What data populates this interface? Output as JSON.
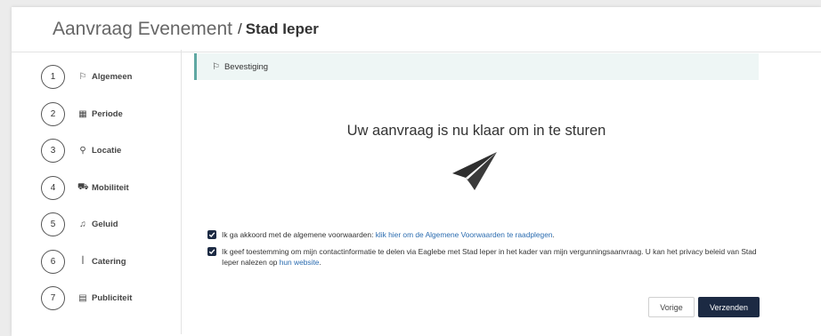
{
  "header": {
    "title": "Aanvraag Evenement",
    "separator": "/",
    "subtitle": "Stad Ieper"
  },
  "steps": [
    {
      "number": "1",
      "icon": "flag-icon",
      "glyph": "⚐",
      "label": "Algemeen"
    },
    {
      "number": "2",
      "icon": "calendar-icon",
      "glyph": "▦",
      "label": "Periode"
    },
    {
      "number": "3",
      "icon": "map-pin-icon",
      "glyph": "⚲",
      "label": "Locatie"
    },
    {
      "number": "4",
      "icon": "car-icon",
      "glyph": "⛟",
      "label": "Mobiliteit"
    },
    {
      "number": "5",
      "icon": "music-icon",
      "glyph": "♫",
      "label": "Geluid"
    },
    {
      "number": "6",
      "icon": "utensils-icon",
      "glyph": "ꟾ",
      "label": "Catering"
    },
    {
      "number": "7",
      "icon": "newspaper-icon",
      "glyph": "▤",
      "label": "Publiciteit"
    }
  ],
  "banner": {
    "icon": "flag-icon",
    "glyph": "⚐",
    "label": "Bevestiging"
  },
  "main": {
    "ready_text": "Uw aanvraag is nu klaar om in te sturen",
    "plane_icon": "paper-plane-icon"
  },
  "consents": [
    {
      "checked": true,
      "text": "Ik ga akkoord met de algemene voorwaarden: ",
      "link_text": "klik hier om de Algemene Voorwaarden te raadplegen",
      "suffix": "."
    },
    {
      "checked": true,
      "text": "Ik geef toestemming om mijn contactinformatie te delen via Eaglebe met Stad Ieper in het kader van mijn vergunningsaanvraag. U kan het privacy beleid van Stad Ieper nalezen op ",
      "link_text": "hun website",
      "suffix": "."
    }
  ],
  "buttons": {
    "previous": "Vorige",
    "submit": "Verzenden"
  },
  "colors": {
    "navy": "#1c2a43",
    "teal_border": "#5fa8a3",
    "banner_bg": "#eef6f5",
    "link": "#2b6cb0"
  }
}
